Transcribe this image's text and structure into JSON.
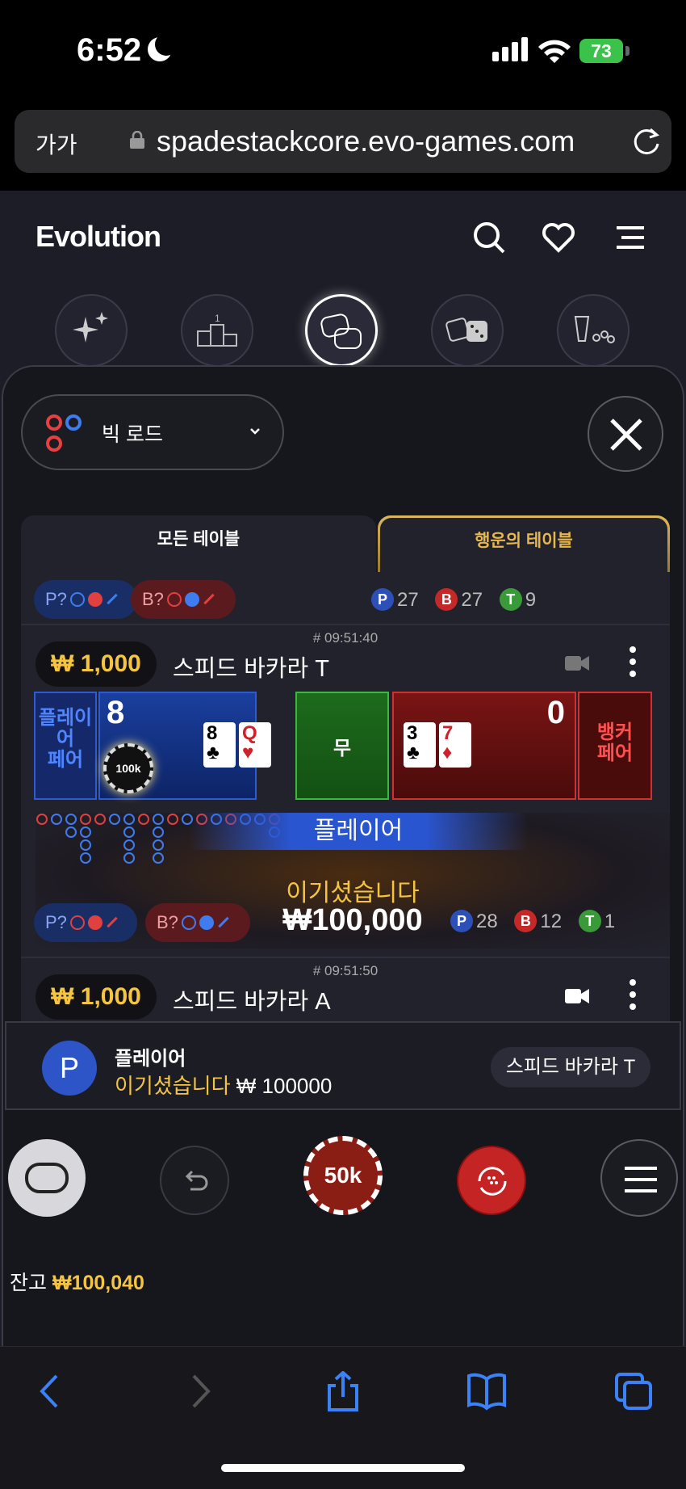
{
  "status_bar": {
    "time": "6:52",
    "battery": "73"
  },
  "browser": {
    "aa_label": "가가",
    "url": "spadestackcore.evo-games.com"
  },
  "site": {
    "logo": "Evolution"
  },
  "road_selector": {
    "label": "빅 로드"
  },
  "tabs": {
    "all": "모든 테이블",
    "lucky": "행운의 테이블"
  },
  "top_row": {
    "p_pred": "P?",
    "b_pred": "B?",
    "counts": [
      {
        "k": "P",
        "v": "27"
      },
      {
        "k": "B",
        "v": "27"
      },
      {
        "k": "T",
        "v": "9"
      }
    ]
  },
  "table_t": {
    "timestamp": "# 09:51:40",
    "limit": "₩ 1,000",
    "name": "스피드 바카라 T",
    "player_pair": "플레이\n어\n페어",
    "player_score": "8",
    "player_cards": [
      {
        "rank": "8",
        "suit": "♣",
        "color": "blk"
      },
      {
        "rank": "Q",
        "suit": "♥",
        "color": "red"
      }
    ],
    "chip_value": "100k",
    "tie": "무",
    "banker_score": "0",
    "banker_cards": [
      {
        "rank": "3",
        "suit": "♣",
        "color": "blk"
      },
      {
        "rank": "7",
        "suit": "♦",
        "color": "red"
      }
    ],
    "banker_pair": "뱅커\n페어",
    "winner": "플레이어",
    "win_msg": "이기셨습니다",
    "win_amount": "₩100,000",
    "p_pred": "P?",
    "b_pred": "B?",
    "counts": [
      {
        "k": "P",
        "v": "28"
      },
      {
        "k": "B",
        "v": "12"
      },
      {
        "k": "T",
        "v": "1"
      }
    ]
  },
  "table_a": {
    "timestamp": "# 09:51:50",
    "limit": "₩ 1,000",
    "name": "스피드 바카라 A"
  },
  "notification": {
    "avatar": "P",
    "title": "플레이어",
    "win_text": "이기셨습니다",
    "amount": "₩ 100000",
    "table_chip": "스피드 바카라 T"
  },
  "controls": {
    "chip": "50k"
  },
  "balance": {
    "label": "잔고",
    "amount": "₩100,040"
  },
  "colors": {
    "player_blue": "#1a3f9e",
    "banker_red": "#7a1414",
    "tie_green": "#1d6b1d",
    "gold": "#f5c542"
  }
}
